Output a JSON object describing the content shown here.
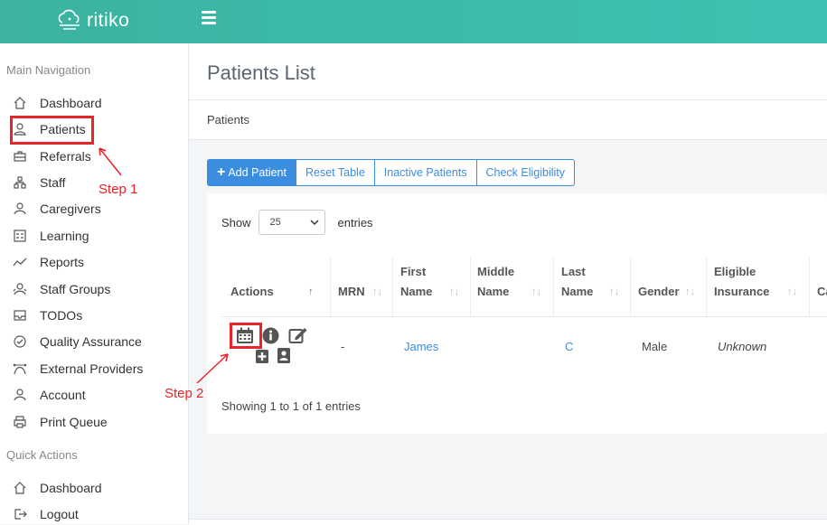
{
  "brand": {
    "name": "ritiko"
  },
  "sidebar": {
    "main_section": "Main Navigation",
    "items": [
      {
        "label": "Dashboard",
        "icon": "home-icon"
      },
      {
        "label": "Patients",
        "icon": "patients-icon"
      },
      {
        "label": "Referrals",
        "icon": "briefcase-icon"
      },
      {
        "label": "Staff",
        "icon": "org-chart-icon"
      },
      {
        "label": "Caregivers",
        "icon": "user-icon"
      },
      {
        "label": "Learning",
        "icon": "checklist-icon"
      },
      {
        "label": "Reports",
        "icon": "trend-icon"
      },
      {
        "label": "Staff Groups",
        "icon": "group-icon"
      },
      {
        "label": "TODOs",
        "icon": "inbox-icon"
      },
      {
        "label": "Quality Assurance",
        "icon": "check-circle-icon"
      },
      {
        "label": "External Providers",
        "icon": "network-icon"
      },
      {
        "label": "Account",
        "icon": "user-icon"
      },
      {
        "label": "Print Queue",
        "icon": "printer-icon"
      }
    ],
    "quick_section": "Quick Actions",
    "quick_items": [
      {
        "label": "Dashboard",
        "icon": "home-icon"
      },
      {
        "label": "Logout",
        "icon": "logout-icon"
      }
    ]
  },
  "page": {
    "title": "Patients List",
    "breadcrumb": "Patients"
  },
  "toolbar": {
    "add_patient": "Add Patient",
    "reset_table": "Reset Table",
    "inactive_patients": "Inactive Patients",
    "check_eligibility": "Check Eligibility"
  },
  "table": {
    "show_label": "Show",
    "entries_label": "entries",
    "page_size": "25",
    "columns": {
      "actions": "Actions",
      "mrn": "MRN",
      "first_name_1": "First",
      "first_name_2": "Name",
      "middle_name_1": "Middle",
      "middle_name_2": "Name",
      "last_name_1": "Last",
      "last_name_2": "Name",
      "gender": "Gender",
      "eligible_1": "Eligible",
      "eligible_2": "Insurance",
      "next_col": "Ca"
    },
    "rows": [
      {
        "mrn": "-",
        "first_name": "James",
        "middle_name": "",
        "last_name": "C",
        "gender": "Male",
        "eligible_insurance": "Unknown"
      }
    ],
    "info": "Showing 1 to 1 of 1 entries"
  },
  "annotations": {
    "step1": "Step 1",
    "step2": "Step 2",
    "color": "#e8232a"
  },
  "colors": {
    "topbar": "#3ec1b1",
    "primary": "#3b8de0"
  }
}
